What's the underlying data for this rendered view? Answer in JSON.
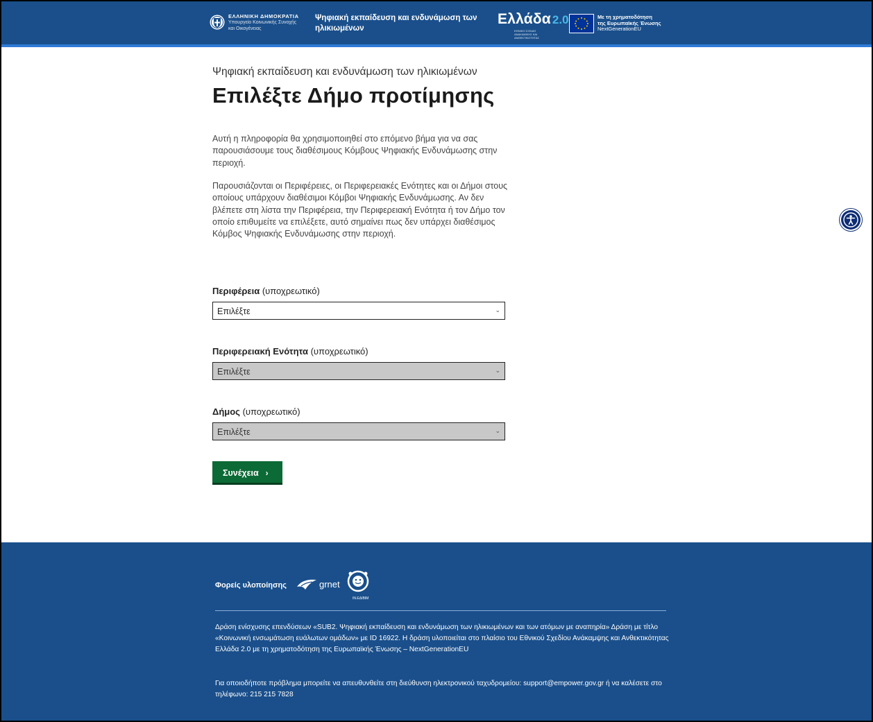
{
  "header": {
    "gov": {
      "line1": "ΕΛΛΗΝΙΚΗ ΔΗΜΟΚΡΑΤΙΑ",
      "line2": "Υπουργείο Κοινωνικής Συνοχής",
      "line3": "και Οικογένειας"
    },
    "title": "Ψηφιακή εκπαίδευση και ενδυνάμωση των ηλικιωμένων",
    "ellada": {
      "word": "Ελλάδα",
      "number": "2.0",
      "subtitle": "ΕΘΝΙΚΟ ΣΧΕΔΙΟ ΑΝΑΚΑΜΨΗΣ ΚΑΙ ΑΝΘΕΚΤΙΚΟΤΗΤΑΣ"
    },
    "eu": {
      "line1": "Με τη χρηματοδότηση",
      "line2": "της Ευρωπαϊκής Ένωσης",
      "line3": "NextGenerationEU"
    }
  },
  "main": {
    "eyebrow": "Ψηφιακή εκπαίδευση και ενδυνάμωση των ηλικιωμένων",
    "title": "Επιλέξτε Δήμο προτίμησης",
    "paragraph1": "Αυτή η πληροφορία θα χρησιμοποιηθεί στο επόμενο βήμα για να σας παρουσιάσουμε τους διαθέσιμους Κόμβους Ψηφιακής Ενδυνάμωσης στην περιοχή.",
    "paragraph2": "Παρουσιάζονται οι Περιφέρειες, οι Περιφερειακές Ενότητες και οι Δήμοι στους οποίους υπάρχουν διαθέσιμοι Κόμβοι Ψηφιακής Ενδυνάμωσης. Αν δεν βλέπετε στη λίστα την Περιφέρεια, την Περιφερειακή Ενότητα ή τον Δήμο τον οποίο επιθυμείτε να επιλέξετε, αυτό σημαίνει πως δεν υπάρχει διαθέσιμος Κόμβος Ψηφιακής Ενδυνάμωσης στην περιοχή.",
    "fields": [
      {
        "label": "Περιφέρεια",
        "hint": "(υποχρεωτικό)",
        "value": "Επιλέξτε",
        "disabled": false
      },
      {
        "label": "Περιφερειακή Ενότητα",
        "hint": "(υποχρεωτικό)",
        "value": "Επιλέξτε",
        "disabled": true
      },
      {
        "label": "Δήμος",
        "hint": "(υποχρεωτικό)",
        "value": "Επιλέξτε",
        "disabled": true
      }
    ],
    "continue_label": "Συνέχεια",
    "continue_arrow": "›"
  },
  "accessibility": {
    "icon": "accessibility-icon"
  },
  "footer": {
    "partners_label": "Φορείς υλοποίησης",
    "grnet": "grnet",
    "ieeaa": "ΙΝ.ΕΔΙΒΙΜ",
    "paragraph1": "Δράση ενίσχυσης επενδύσεων «SUB2. Ψηφιακή εκπαίδευση και ενδυνάμωση των ηλικιωμένων και των ατόμων με αναπηρία» Δράση με τίτλο «Κοινωνική ενσωμάτωση ευάλωτων ομάδων» με ID 16922. Η δράση υλοποιείται στο πλαίσιο του Εθνικού Σχεδίου Ανάκαμψης και Ανθεκτικότητας Ελλάδα 2.0 με τη χρηματοδότηση της Ευρωπαϊκής Ένωσης – NextGenerationEU",
    "paragraph2": "Για οποιοδήποτε πρόβλημα μπορείτε να απευθυνθείτε στη διεύθυνση ηλεκτρονικού ταχυδρομείου: support@empower.gov.gr ή να καλέσετε στο τηλέφωνο: 215 215 7828"
  },
  "colors": {
    "header_bg": "#1a4f8b",
    "header_border": "#2e7bd6",
    "button_green": "#0b6a35",
    "disabled_select": "#c8c8c8",
    "accessibility_blue": "#0d2d74"
  }
}
